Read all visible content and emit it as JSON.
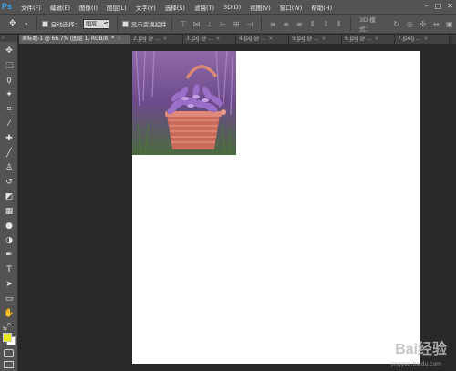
{
  "app": {
    "logo": "Ps"
  },
  "menu": [
    "文件(F)",
    "编辑(E)",
    "图像(I)",
    "图层(L)",
    "文字(Y)",
    "选择(S)",
    "滤镜(T)",
    "3D(D)",
    "视图(V)",
    "窗口(W)",
    "帮助(H)"
  ],
  "window_controls": {
    "minimize": "–",
    "maximize": "□",
    "close": "✕"
  },
  "options": {
    "tool_icon": "move-tool-icon",
    "auto_select_label": "自动选择：",
    "auto_select_value": "图层",
    "show_transform_label": "显示变换控件",
    "mode_3d_label": "3D 模式："
  },
  "tabs": [
    {
      "label": "未标题-1 @ 66.7% (图层 1, RGB/8) *",
      "active": true
    },
    {
      "label": "2.jpg @ ...",
      "active": false
    },
    {
      "label": "3.jpg @ ...",
      "active": false
    },
    {
      "label": "4.jpg @ ...",
      "active": false
    },
    {
      "label": "5.jpg @ ...",
      "active": false
    },
    {
      "label": "6.jpg @ ...",
      "active": false
    },
    {
      "label": "7.jpeg ...",
      "active": false
    }
  ],
  "colors": {
    "foreground": "#e9e81a",
    "background": "#ffffff",
    "accent": "#31a8ff"
  },
  "watermark": {
    "brand": "Bai",
    "brand_suffix": "经验",
    "url": "jingyan.baidu.com"
  }
}
